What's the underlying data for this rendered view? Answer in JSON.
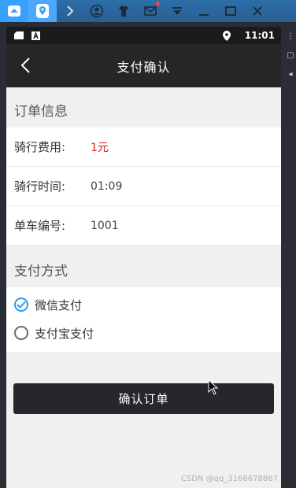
{
  "statusbar": {
    "time": "11:01"
  },
  "appbar": {
    "title": "支付确认"
  },
  "order_section": {
    "heading": "订单信息",
    "rows": [
      {
        "label": "骑行费用:",
        "value": "1元"
      },
      {
        "label": "骑行时间:",
        "value": "01:09"
      },
      {
        "label": "单车编号:",
        "value": "1001"
      }
    ]
  },
  "pay_section": {
    "heading": "支付方式",
    "options": [
      {
        "label": "微信支付",
        "selected": true
      },
      {
        "label": "支付宝支付",
        "selected": false
      }
    ]
  },
  "confirm_button": {
    "label": "确认订单"
  },
  "watermark": "CSDN @qq_3166678867",
  "colors": {
    "accent_red": "#d6211c",
    "radio_blue": "#2a9be7",
    "appbar": "#262628"
  }
}
